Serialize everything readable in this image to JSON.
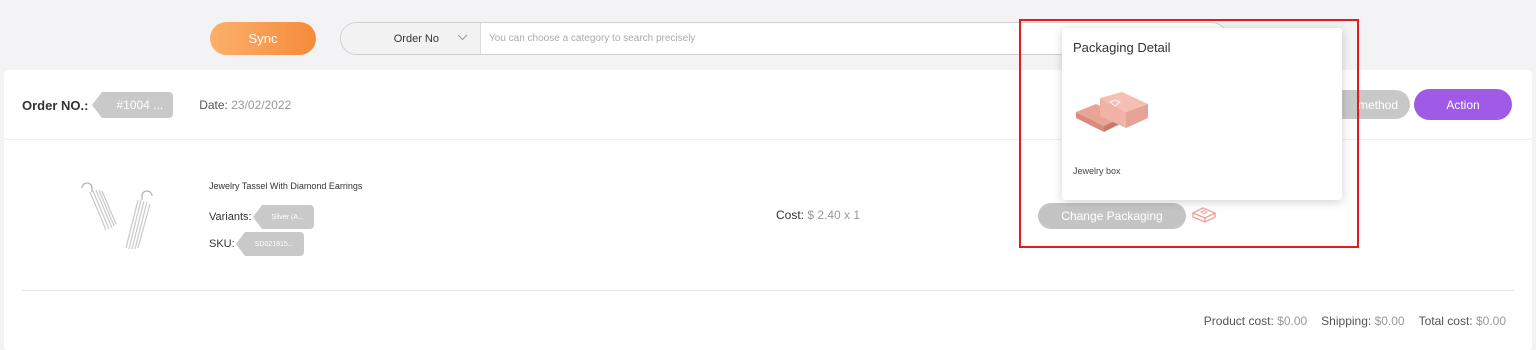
{
  "toolbar": {
    "sync_label": "Sync",
    "search_category": "Order No",
    "search_placeholder": "You can choose a category to search precisely"
  },
  "order": {
    "number_label": "Order NO.:",
    "number_value": "#1004 ...",
    "date_label": "Date:",
    "date_value": "23/02/2022",
    "method_label": "method",
    "action_label": "Action"
  },
  "product": {
    "name": "Jewelry Tassel With Diamond Earrings",
    "variants_label": "Variants:",
    "variants_value": "Silver (A...",
    "sku_label": "SKU:",
    "sku_value": "SD021915...",
    "cost_label": "Cost:",
    "cost_value": "$ 2.40 x 1",
    "change_packaging_label": "Change Packaging"
  },
  "totals": {
    "product_cost_label": "Product cost:",
    "product_cost_value": "$0.00",
    "shipping_label": "Shipping:",
    "shipping_value": "$0.00",
    "total_label": "Total cost:",
    "total_value": "$0.00"
  },
  "popover": {
    "title": "Packaging Detail",
    "item_name": "Jewelry box"
  },
  "icons": {
    "chevron": "chevron-down-icon",
    "box": "jewelry-box-icon"
  },
  "colors": {
    "sync_gradient_start": "#fbb06a",
    "sync_gradient_end": "#f68a3c",
    "action": "#a05be6",
    "highlight": "#e01b22"
  }
}
